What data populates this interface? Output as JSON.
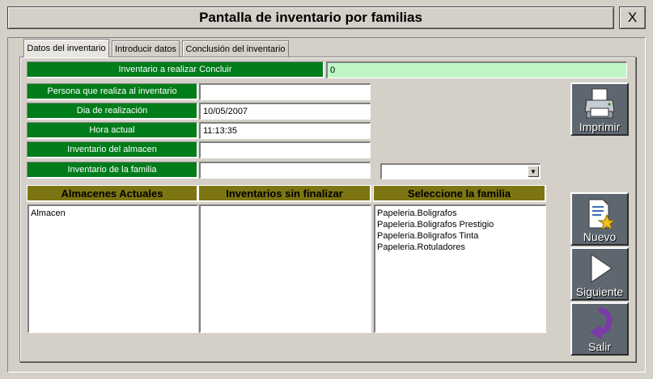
{
  "window": {
    "title": "Pantalla de inventario por familias",
    "close_label": "X"
  },
  "tabs": [
    {
      "label": "Datos del inventario",
      "active": true
    },
    {
      "label": "Introducir datos",
      "active": false
    },
    {
      "label": "Conclusión del inventario",
      "active": false
    }
  ],
  "form": {
    "inventario_label": "Inventario a realizar Concluir",
    "inventario_value": "0",
    "persona_label": "Persona que realiza al inventario",
    "persona_value": "",
    "dia_label": "Dia de realización",
    "dia_value": "10/05/2007",
    "hora_label": "Hora actual",
    "hora_value": "11:13:35",
    "almacen_label": "Inventario del almacen",
    "almacen_value": "",
    "familia_label": "Inventario de la familia",
    "familia_value": "",
    "combo_value": ""
  },
  "lists": {
    "almacenes": {
      "header": "Almacenes Actuales",
      "items": [
        "Almacen"
      ]
    },
    "sin_finalizar": {
      "header": "Inventarios sin finalizar",
      "items": []
    },
    "familias": {
      "header": "Seleccione la familia",
      "items": [
        "Papeleria.Boligrafos",
        "Papeleria.Boligrafos Prestigio",
        "Papeleria.Boligrafos Tinta",
        "Papeleria.Rotuladores"
      ]
    }
  },
  "buttons": {
    "imprimir": {
      "label": "Imprimir",
      "icon": "printer-icon"
    },
    "nuevo": {
      "label": "Nuevo",
      "icon": "new-document-icon"
    },
    "siguiente": {
      "label": "Siguiente",
      "icon": "play-arrow-icon"
    },
    "salir": {
      "label": "Salir",
      "icon": "curved-arrow-icon"
    }
  },
  "colors": {
    "label_green": "#007c1a",
    "field_lightgreen": "#bff5c6",
    "header_olive": "#7d7511",
    "button_gray": "#5e6770"
  }
}
